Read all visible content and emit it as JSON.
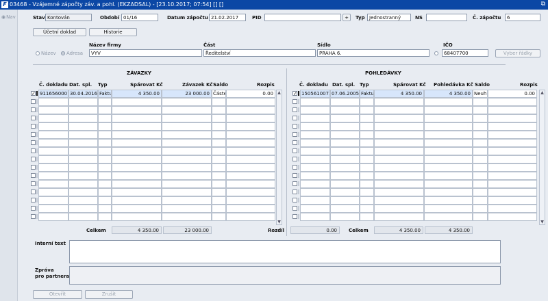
{
  "window": {
    "title": "03468 - Vzájemné zápočty záv. a pohl. (EKZADSAL) - [23.10.2017; 07:54] [] []",
    "nav_label": "Nav"
  },
  "header": {
    "stav_label": "Stav",
    "stav_value": "Kontován",
    "obdobi_label": "Období",
    "obdobi_value": "01/16",
    "datum_label": "Datum zápočtu",
    "datum_value": "21.02.2017",
    "pid_label": "PID",
    "pid_value": "",
    "pid_button": "+",
    "typ_label": "Typ",
    "typ_value": "Jednostranný",
    "ns_label": "NS",
    "ns_value": "",
    "cislo_label": "Č. zápočtu",
    "cislo_value": "6"
  },
  "buttons": {
    "ucetni_doklad": "Účetní doklad",
    "historie": "Historie",
    "vyber_radky": "Vyber řádky",
    "otevrit": "Otevřít",
    "zrusit": "Zrušit"
  },
  "partner": {
    "radio_nazev": "Název",
    "radio_adresa": "Adresa",
    "nazev_label": "Název firmy",
    "nazev_value": "VYV",
    "cast_label": "Část",
    "cast_value": "Ředitelství",
    "sidlo_label": "Sídlo",
    "sidlo_value": "PRAHA 6.",
    "ico_label": "IČO",
    "ico_value": "68407700"
  },
  "zavazky": {
    "title": "ZÁVAZKY",
    "columns": [
      "Č. dokladu",
      "Dat. spl.",
      "Typ",
      "Spárovat Kč",
      "Závazek Kč",
      "Saldo",
      "Rozpis"
    ],
    "rows": [
      {
        "checked": true,
        "doklad": "9116560001",
        "dat": "30.04.2016",
        "typ": "Faktu",
        "sparovat": "4 350.00",
        "zavazek": "23 000.00",
        "saldo": "Částe",
        "rozpis": "0.00"
      }
    ],
    "total_label": "Celkem",
    "total_sparovat": "4 350.00",
    "total_zavazek": "23 000.00"
  },
  "pohledavky": {
    "title": "POHLEDÁVKY",
    "columns": [
      "Č. dokladu",
      "Dat. spl.",
      "Typ",
      "Spárovat Kč",
      "Pohledávka Kč",
      "Saldo",
      "Rozpis"
    ],
    "rows": [
      {
        "checked": true,
        "doklad": "1505610073",
        "dat": "07.06.2005",
        "typ": "Faktu",
        "sparovat": "4 350.00",
        "pohledavka": "4 350.00",
        "saldo": "Neuh",
        "rozpis": "0.00"
      }
    ],
    "rozdil_label": "Rozdíl",
    "rozdil_value": "0.00",
    "total_label": "Celkem",
    "total_sparovat": "4 350.00",
    "total_pohledavka": "4 350.00"
  },
  "bottom": {
    "interni_label": "Interní text",
    "interni_value": "",
    "zprava_label_1": "Zpráva",
    "zprava_label_2": "pro partnera",
    "zprava_value": ""
  },
  "colors": {
    "titlebar": "#0b47a5",
    "selected_row": "#d7e6fb"
  }
}
